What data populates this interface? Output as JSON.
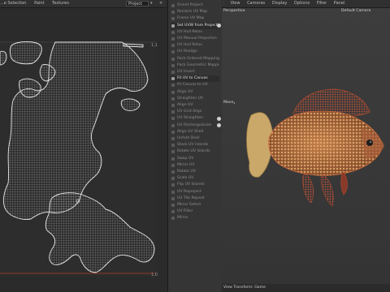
{
  "uv_editor": {
    "menu": [
      "...e Selection",
      "Paint",
      "Textures"
    ],
    "project_select": "Project",
    "corner_top_right": "1,1",
    "corner_bottom_right": "1,0"
  },
  "tools": {
    "items": [
      {
        "label": "Orient Project",
        "bright": false
      },
      {
        "label": "Reclaim UV Map",
        "bright": false
      },
      {
        "label": "Frame UV Map",
        "bright": false
      },
      {
        "label": "Set UVW from Projection",
        "bright": true,
        "header": true,
        "gear": true
      },
      {
        "label": "UV Hull Relax",
        "bright": false
      },
      {
        "label": "UV Manual Projection",
        "bright": false
      },
      {
        "label": "UV Hull Relax",
        "bright": false
      },
      {
        "label": "UV Realign",
        "bright": false
      },
      {
        "label": "Pack Ordered Mapping",
        "bright": false
      },
      {
        "label": "Pack Geometric Mapping",
        "bright": false
      },
      {
        "label": "UV Invert",
        "bright": false
      },
      {
        "label": "Fit UV to Canvas",
        "bright": true,
        "header": true,
        "gear": false
      },
      {
        "label": "Fit Canvas to UV",
        "bright": false
      },
      {
        "label": "Align UV",
        "bright": false
      },
      {
        "label": "Straighten UV",
        "bright": false
      },
      {
        "label": "Align UV",
        "bright": false
      },
      {
        "label": "UV Grid Align",
        "bright": false
      },
      {
        "label": "UV Straighten",
        "bright": false,
        "gear": true
      },
      {
        "label": "UV Rectangularize",
        "bright": false,
        "gear": true
      },
      {
        "label": "Align UV Shell",
        "bright": false
      },
      {
        "label": "Unfold Shell",
        "bright": false
      },
      {
        "label": "Stack UV Islands",
        "bright": false
      },
      {
        "label": "Rotate UV Islands",
        "bright": false
      },
      {
        "label": "Swap UV",
        "bright": false
      },
      {
        "label": "Mirror UV",
        "bright": false
      },
      {
        "label": "Rotate UV",
        "bright": false
      },
      {
        "label": "Scale UV",
        "bright": false
      },
      {
        "label": "Flip UV Islands",
        "bright": false
      },
      {
        "label": "UV Reproject",
        "bright": false
      },
      {
        "label": "UV Tile Repeat",
        "bright": false
      },
      {
        "label": "Mirror Select",
        "bright": false
      },
      {
        "label": "UV Filter",
        "bright": false
      },
      {
        "label": "Mirror",
        "bright": false
      }
    ]
  },
  "viewport": {
    "menu": [
      "View",
      "Cameras",
      "Display",
      "Options",
      "Filter",
      "Panel"
    ],
    "view_label": "Perspective",
    "camera_label": "Default Camera",
    "move_label": "Move",
    "status": "View Transform: Game"
  },
  "colors": {
    "uv_wire": "#d9d9d9",
    "uv_border": "#c0392b",
    "fish_orange": "#c9683a"
  }
}
